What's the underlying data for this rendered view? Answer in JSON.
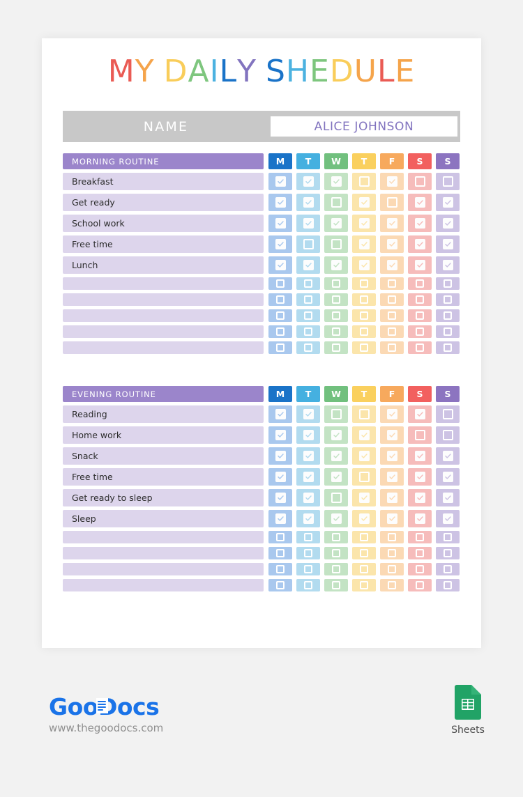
{
  "document": {
    "title_letters": [
      {
        "ch": "M",
        "color": "#ea5b54"
      },
      {
        "ch": "Y",
        "color": "#f5a44b"
      },
      {
        "ch": " ",
        "color": ""
      },
      {
        "ch": "D",
        "color": "#f9cd5a"
      },
      {
        "ch": "A",
        "color": "#7ec67e"
      },
      {
        "ch": "I",
        "color": "#4cb2e0"
      },
      {
        "ch": "L",
        "color": "#1a73c8"
      },
      {
        "ch": "Y",
        "color": "#8274bf"
      },
      {
        "ch": " ",
        "color": ""
      },
      {
        "ch": "S",
        "color": "#1a73c8"
      },
      {
        "ch": "H",
        "color": "#4cb2e0"
      },
      {
        "ch": "E",
        "color": "#7ec67e"
      },
      {
        "ch": "D",
        "color": "#f9cd5a"
      },
      {
        "ch": "U",
        "color": "#f5a44b"
      },
      {
        "ch": "L",
        "color": "#ea5b54"
      },
      {
        "ch": "E",
        "color": "#f5a44b"
      }
    ],
    "title_text": "MY DAILY SHEDULE"
  },
  "name_field": {
    "label": "NAME",
    "value": "ALICE JOHNSON",
    "placeholder": "ALICE JOHNSON"
  },
  "days": [
    {
      "short": "M",
      "full": "Monday",
      "header_color": "#1a73c8",
      "cell_color": "#a9c8ee",
      "tick_color": "#a9c8ee"
    },
    {
      "short": "T",
      "full": "Tuesday",
      "header_color": "#45b0e0",
      "cell_color": "#b2dbef",
      "tick_color": "#b2dbef"
    },
    {
      "short": "W",
      "full": "Wednesday",
      "header_color": "#71c07e",
      "cell_color": "#c3e3c4",
      "tick_color": "#c3e3c4"
    },
    {
      "short": "T",
      "full": "Thursday",
      "header_color": "#fad05e",
      "cell_color": "#fbe5ab",
      "tick_color": "#fbe5ab"
    },
    {
      "short": "F",
      "full": "Friday",
      "header_color": "#f7a95d",
      "cell_color": "#fbd9b4",
      "tick_color": "#fbd9b4"
    },
    {
      "short": "S",
      "full": "Saturday",
      "header_color": "#f2605f",
      "cell_color": "#f6bcbb",
      "tick_color": "#f6bcbb"
    },
    {
      "short": "S",
      "full": "Sunday",
      "header_color": "#8c74c0",
      "cell_color": "#cdc3e4",
      "tick_color": "#cdc3e4"
    }
  ],
  "sections": [
    {
      "id": "morning",
      "title": "MORNING ROUTINE",
      "rows": [
        {
          "label": "Breakfast",
          "checks": [
            true,
            true,
            true,
            false,
            true,
            false,
            false
          ]
        },
        {
          "label": "Get ready",
          "checks": [
            true,
            true,
            false,
            true,
            false,
            true,
            true
          ]
        },
        {
          "label": "School work",
          "checks": [
            true,
            true,
            true,
            true,
            true,
            true,
            true
          ]
        },
        {
          "label": "Free time",
          "checks": [
            true,
            false,
            false,
            true,
            true,
            true,
            true
          ]
        },
        {
          "label": "Lunch",
          "checks": [
            true,
            true,
            true,
            true,
            true,
            true,
            true
          ]
        }
      ],
      "empty_rows": 5
    },
    {
      "id": "evening",
      "title": "EVENING ROUTINE",
      "rows": [
        {
          "label": "Reading",
          "checks": [
            true,
            true,
            false,
            false,
            true,
            true,
            false
          ]
        },
        {
          "label": "Home work",
          "checks": [
            true,
            true,
            true,
            true,
            true,
            false,
            false
          ]
        },
        {
          "label": "Snack",
          "checks": [
            true,
            true,
            true,
            true,
            true,
            true,
            true
          ]
        },
        {
          "label": "Free time",
          "checks": [
            true,
            true,
            true,
            false,
            true,
            true,
            true
          ]
        },
        {
          "label": "Get ready to sleep",
          "checks": [
            true,
            true,
            false,
            true,
            true,
            true,
            true
          ]
        },
        {
          "label": "Sleep",
          "checks": [
            true,
            true,
            true,
            true,
            true,
            true,
            true
          ]
        }
      ],
      "empty_rows": 4
    }
  ],
  "footer": {
    "logo_text_goo": "Goo",
    "logo_text_docs": "Docs",
    "url": "www.thegoodocs.com",
    "sheets_caption": "Sheets"
  },
  "colors": {
    "section_header_bg": "#9b85cb",
    "row_bg": "#ddd5ec",
    "name_bar_bg": "#c8c8c8",
    "name_value_color": "#8274bf",
    "sheets_green": "#21a366",
    "logo_blue": "#1a73e8"
  }
}
